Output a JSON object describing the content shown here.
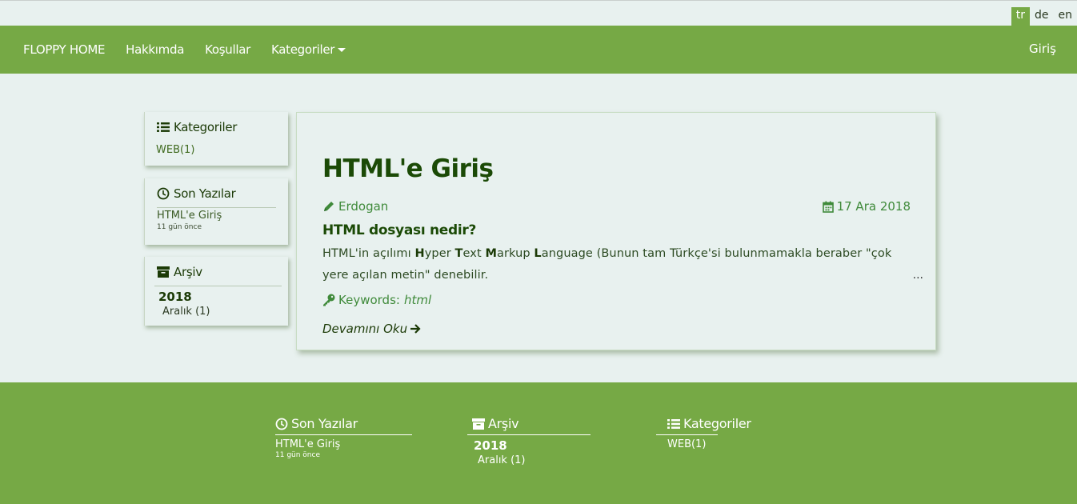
{
  "languages": [
    {
      "code": "tr",
      "active": true
    },
    {
      "code": "de",
      "active": false
    },
    {
      "code": "en",
      "active": false
    }
  ],
  "navbar": {
    "brand": "FLOPPY HOME",
    "items": [
      "Hakkımda",
      "Koşullar",
      "Kategoriler"
    ],
    "login": "Giriş",
    "bg_color": "#76a945"
  },
  "sidebar": {
    "categories": {
      "title": "Kategoriler",
      "items": [
        "WEB(1)"
      ]
    },
    "recent": {
      "title": "Son Yazılar",
      "post_title": "HTML'e Giriş",
      "post_age": "11 gün önce"
    },
    "archive": {
      "title": "Arşiv",
      "year": "2018",
      "month": "Aralık (1)"
    }
  },
  "post": {
    "title": "HTML'e Giriş",
    "author": "Erdogan",
    "date": "17 Ara 2018",
    "subtitle": "HTML dosyası nedir?",
    "text_before": "HTML'in açılımı ",
    "acronym": [
      {
        "letter": "H",
        "rest": "yper "
      },
      {
        "letter": "T",
        "rest": "ext "
      },
      {
        "letter": "M",
        "rest": "arkup "
      },
      {
        "letter": "L",
        "rest": "anguage"
      }
    ],
    "text_after": " (Bunun tam Türkçe'si bulunmamakla beraber \"çok yere açılan metin\" denebilir.",
    "ellipsis": "...",
    "keywords_label": "Keywords:",
    "keywords": "html",
    "read_more": "Devamını Oku"
  },
  "footer": {
    "recent": {
      "title": "Son Yazılar",
      "post_title": "HTML'e Giriş",
      "post_age": "11 gün önce"
    },
    "archive": {
      "title": "Arşiv",
      "year": "2018",
      "month": "Aralık (1)"
    },
    "categories": {
      "title": "Kategoriler",
      "items": [
        "WEB(1)"
      ]
    }
  },
  "icons": [
    "list-icon",
    "clock-icon",
    "archive-icon",
    "pencil-icon",
    "calendar-icon",
    "key-icon",
    "arrow-right-icon"
  ]
}
